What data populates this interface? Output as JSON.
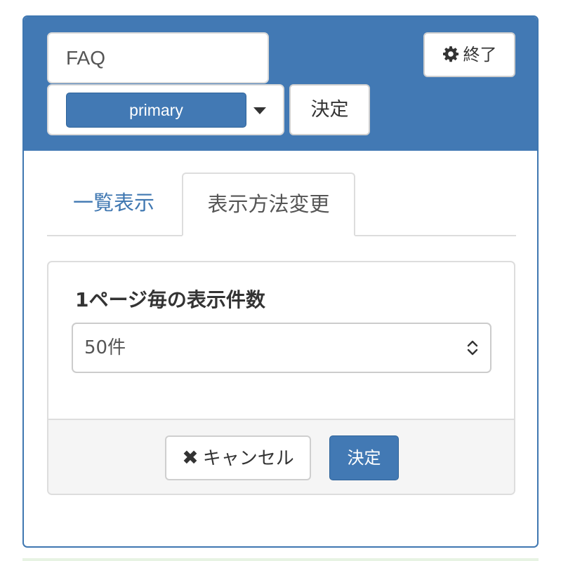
{
  "header": {
    "title_value": "FAQ",
    "style_selected": "primary",
    "decide_label": "決定",
    "finish_label": "終了"
  },
  "tabs": [
    {
      "label": "一覧表示",
      "active": false
    },
    {
      "label": "表示方法変更",
      "active": true
    }
  ],
  "settings": {
    "per_page_label": "1ページ毎の表示件数",
    "per_page_value": "50件",
    "cancel_label": "キャンセル",
    "submit_label": "決定"
  },
  "colors": {
    "primary": "#4279b4",
    "border": "#dddddd",
    "footer_bg": "#f5f5f5"
  },
  "icons": {
    "finish": "gear-icon",
    "cancel": "close-icon",
    "select": "caret-down-icon",
    "count_select": "up-down-chevron-icon"
  }
}
